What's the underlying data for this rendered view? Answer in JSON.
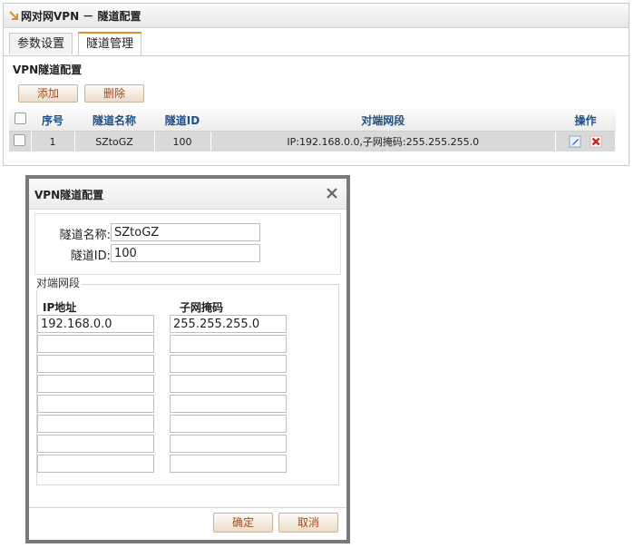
{
  "panel": {
    "title": "网对网VPN － 隧道配置",
    "tabs": [
      {
        "label": "参数设置",
        "active": false
      },
      {
        "label": "隧道管理",
        "active": true
      }
    ],
    "group_title": "VPN隧道配置",
    "buttons": {
      "add": "添加",
      "delete": "删除"
    },
    "table": {
      "headers": [
        "序号",
        "隧道名称",
        "隧道ID",
        "对端网段",
        "操作"
      ],
      "rows": [
        {
          "index": "1",
          "name": "SZtoGZ",
          "id": "100",
          "remote": "IP:192.168.0.0,子网掩码:255.255.255.0"
        }
      ]
    }
  },
  "dialog": {
    "title": "VPN隧道配置",
    "name_label": "隧道名称:",
    "name_value": "SZtoGZ",
    "id_label": "隧道ID:",
    "id_value": "100",
    "legend": "对端网段",
    "ip_header": "IP地址",
    "mask_header": "子网掩码",
    "rows": [
      {
        "ip": "192.168.0.0",
        "mask": "255.255.255.0"
      },
      {
        "ip": "",
        "mask": ""
      },
      {
        "ip": "",
        "mask": ""
      },
      {
        "ip": "",
        "mask": ""
      },
      {
        "ip": "",
        "mask": ""
      },
      {
        "ip": "",
        "mask": ""
      },
      {
        "ip": "",
        "mask": ""
      },
      {
        "ip": "",
        "mask": ""
      }
    ],
    "ok": "确定",
    "cancel": "取消"
  },
  "colors": {
    "accent": "#e08a2c",
    "button_text": "#a74a13",
    "header_text": "#1f4f85",
    "delete_red": "#d42020"
  }
}
